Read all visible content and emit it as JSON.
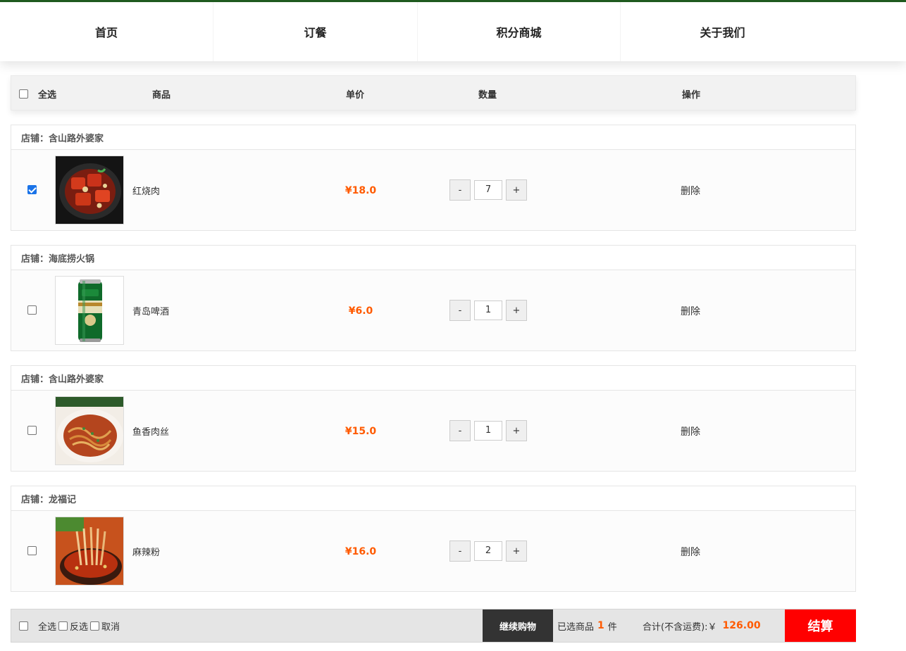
{
  "nav": [
    "首页",
    "订餐",
    "积分商城",
    "关于我们"
  ],
  "header": {
    "select_all": "全选",
    "product": "商品",
    "unit_price": "单价",
    "quantity": "数量",
    "operation": "操作"
  },
  "shops": [
    {
      "title": "店铺：含山路外婆家",
      "item": {
        "name": "红烧肉",
        "price": "¥18.0",
        "qty": "7",
        "checked": true,
        "image": "braised-pork-photo"
      }
    },
    {
      "title": "店铺：海底捞火锅",
      "item": {
        "name": "青岛啤酒",
        "price": "¥6.0",
        "qty": "1",
        "checked": false,
        "image": "beer-can-photo"
      }
    },
    {
      "title": "店铺：含山路外婆家",
      "item": {
        "name": "鱼香肉丝",
        "price": "¥15.0",
        "qty": "1",
        "checked": false,
        "image": "shredded-pork-photo"
      }
    },
    {
      "title": "店铺：龙福记",
      "item": {
        "name": "麻辣粉",
        "price": "¥16.0",
        "qty": "2",
        "checked": false,
        "image": "spicy-noodles-photo"
      }
    }
  ],
  "qty_minus": "-",
  "qty_plus": "+",
  "delete_label": "删除",
  "footer": {
    "select_all": "全选",
    "invert": "反选",
    "cancel": "取消",
    "continue": "继续购物",
    "selected_prefix": "已选商品",
    "selected_count": "1",
    "selected_suffix": "件",
    "total_label": "合计(不含运费):￥",
    "total": "126.00",
    "checkout": "结算"
  },
  "colors": {
    "accent": "#ff5a00",
    "checkout": "#ff0000",
    "nav_border": "#1f5a1f"
  }
}
